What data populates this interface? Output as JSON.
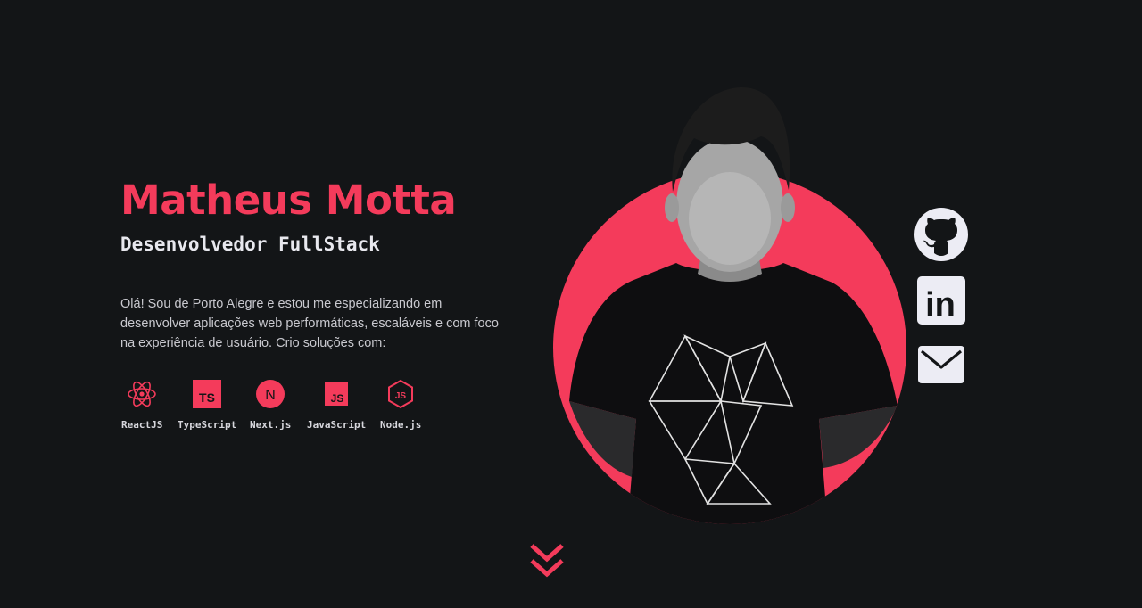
{
  "hero": {
    "name": "Matheus Motta",
    "role": "Desenvolvedor FullStack",
    "bio": "Olá! Sou de Porto Alegre e estou me especializando em desenvolver aplicações web performáticas, escaláveis e com foco na experiência de usuário. Crio soluções com:"
  },
  "technologies": [
    {
      "label": "ReactJS",
      "icon": "react-icon"
    },
    {
      "label": "TypeScript",
      "icon": "typescript-icon",
      "badge": "TS"
    },
    {
      "label": "Next.js",
      "icon": "nextjs-icon",
      "badge": "N"
    },
    {
      "label": "JavaScript",
      "icon": "javascript-icon",
      "badge": "JS"
    },
    {
      "label": "Node.js",
      "icon": "nodejs-icon",
      "badge": "JS"
    }
  ],
  "social": [
    {
      "name": "github",
      "icon": "github-icon"
    },
    {
      "name": "linkedin",
      "icon": "linkedin-icon",
      "glyph": "in"
    },
    {
      "name": "email",
      "icon": "mail-icon"
    }
  ],
  "colors": {
    "background": "#131517",
    "accent": "#f43b5b",
    "text": "#e8e8ee",
    "muted": "#c9c9cf",
    "icon_light": "#ececf4"
  }
}
